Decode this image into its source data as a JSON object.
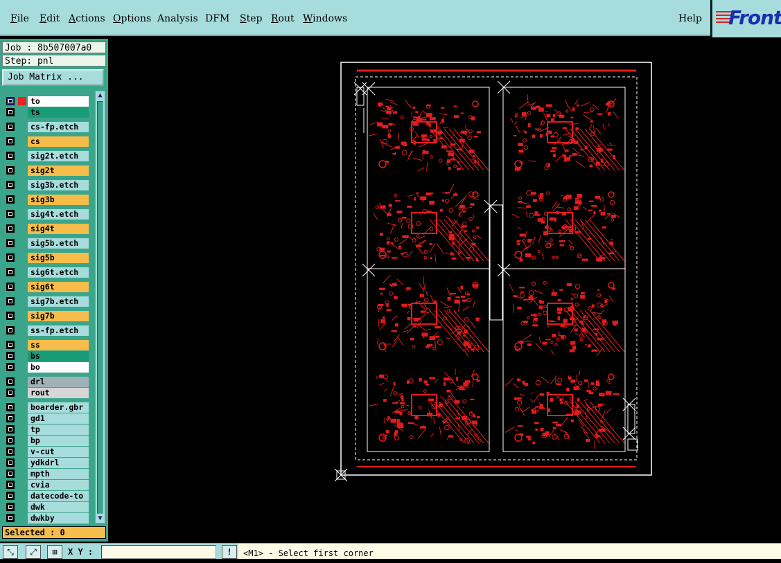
{
  "menu": {
    "items": [
      {
        "label": "File",
        "u": 0
      },
      {
        "label": "Edit",
        "u": 0
      },
      {
        "label": "Actions",
        "u": 0
      },
      {
        "label": "Options",
        "u": 0
      },
      {
        "label": "Analysis",
        "u": -1
      },
      {
        "label": "DFM",
        "u": -1
      },
      {
        "label": "Step",
        "u": 0
      },
      {
        "label": "Rout",
        "u": 0
      },
      {
        "label": "Windows",
        "u": 0
      }
    ],
    "help": "Help"
  },
  "logo": {
    "text": "Front"
  },
  "job": {
    "label": "Job : 8b507007a0",
    "step": "Step: pnl",
    "matrix_button": "Job Matrix ..."
  },
  "layers": [
    {
      "name": "to",
      "color": "#ffffff",
      "check": "active"
    },
    {
      "name": "ts",
      "color": "#1a9b77"
    },
    {
      "name": "cs-fp.etch",
      "color": "#a7dcdc"
    },
    {
      "name": "cs",
      "color": "#f7bd4a"
    },
    {
      "name": "sig2t.etch",
      "color": "#a7dcdc"
    },
    {
      "name": "sig2t",
      "color": "#f7bd4a"
    },
    {
      "name": "sig3b.etch",
      "color": "#a7dcdc"
    },
    {
      "name": "sig3b",
      "color": "#f7bd4a"
    },
    {
      "name": "sig4t.etch",
      "color": "#a7dcdc"
    },
    {
      "name": "sig4t",
      "color": "#f7bd4a"
    },
    {
      "name": "sig5b.etch",
      "color": "#a7dcdc"
    },
    {
      "name": "sig5b",
      "color": "#f7bd4a"
    },
    {
      "name": "sig6t.etch",
      "color": "#a7dcdc"
    },
    {
      "name": "sig6t",
      "color": "#f7bd4a"
    },
    {
      "name": "sig7b.etch",
      "color": "#a7dcdc"
    },
    {
      "name": "sig7b",
      "color": "#f7bd4a"
    },
    {
      "name": "ss-fp.etch",
      "color": "#a7dcdc"
    },
    {
      "name": "ss",
      "color": "#f7bd4a"
    },
    {
      "name": "bs",
      "color": "#1a9b77"
    },
    {
      "name": "bo",
      "color": "#ffffff"
    },
    {
      "name": "drl",
      "color": "#9fb2b8"
    },
    {
      "name": "rout",
      "color": "#d6d6d6"
    },
    {
      "name": "boarder.gbr",
      "color": "#a7dcdc"
    },
    {
      "name": "gd1",
      "color": "#a7dcdc"
    },
    {
      "name": "tp",
      "color": "#a7dcdc"
    },
    {
      "name": "bp",
      "color": "#a7dcdc"
    },
    {
      "name": "v-cut",
      "color": "#a7dcdc"
    },
    {
      "name": "ydkdrl",
      "color": "#a7dcdc"
    },
    {
      "name": "mpth",
      "color": "#a7dcdc"
    },
    {
      "name": "cvia",
      "color": "#a7dcdc"
    },
    {
      "name": "datecode-to",
      "color": "#a7dcdc"
    },
    {
      "name": "dwk",
      "color": "#a7dcdc"
    },
    {
      "name": "dwkby",
      "color": "#a7dcdc"
    }
  ],
  "selected": "Selected : 0",
  "bottom": {
    "xy_label": "X Y :",
    "xy_value": "",
    "exclaim": "!",
    "status": "<M1> - Select first corner"
  }
}
